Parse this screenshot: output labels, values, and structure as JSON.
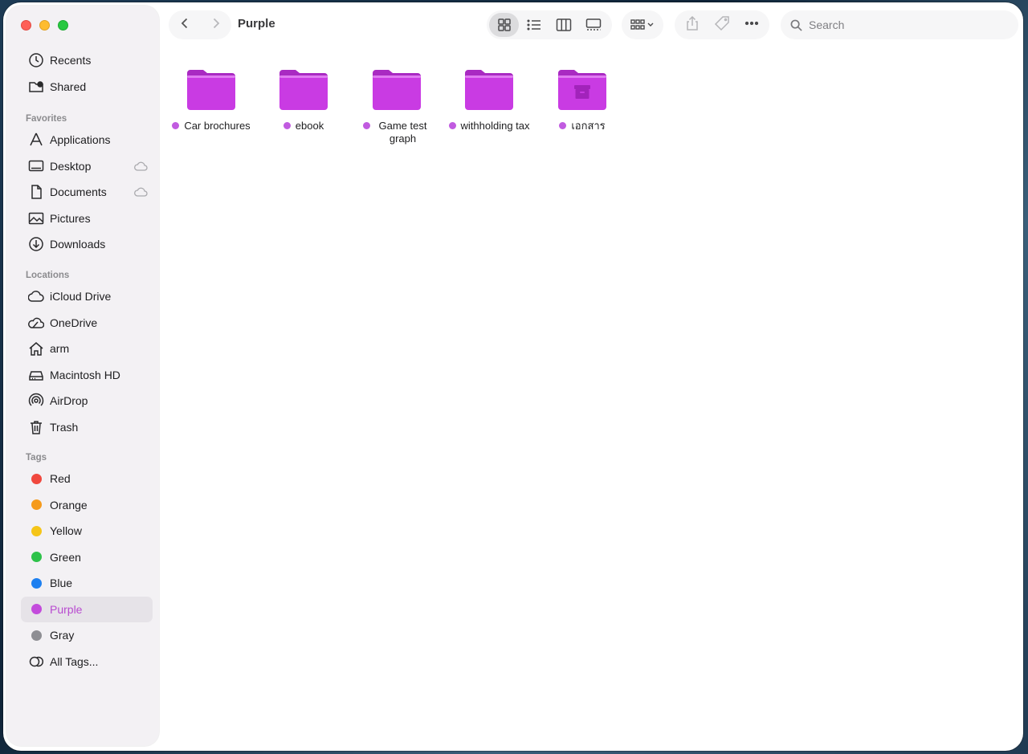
{
  "window": {
    "title": "Purple"
  },
  "sidebar": {
    "top_items": [
      {
        "label": "Recents",
        "icon": "clock-icon"
      },
      {
        "label": "Shared",
        "icon": "shared-folder-icon"
      }
    ],
    "favorites": {
      "heading": "Favorites",
      "items": [
        {
          "label": "Applications",
          "icon": "applications-icon",
          "cloud": false
        },
        {
          "label": "Desktop",
          "icon": "desktop-icon",
          "cloud": true
        },
        {
          "label": "Documents",
          "icon": "document-icon",
          "cloud": true
        },
        {
          "label": "Pictures",
          "icon": "pictures-icon",
          "cloud": false
        },
        {
          "label": "Downloads",
          "icon": "download-icon",
          "cloud": false
        }
      ]
    },
    "locations": {
      "heading": "Locations",
      "items": [
        {
          "label": "iCloud Drive",
          "icon": "cloud-icon"
        },
        {
          "label": "OneDrive",
          "icon": "onedrive-icon"
        },
        {
          "label": "arm",
          "icon": "home-icon"
        },
        {
          "label": "Macintosh HD",
          "icon": "hard-drive-icon"
        },
        {
          "label": "AirDrop",
          "icon": "airdrop-icon"
        },
        {
          "label": "Trash",
          "icon": "trash-icon"
        }
      ]
    },
    "tags": {
      "heading": "Tags",
      "items": [
        {
          "label": "Red",
          "color": "#f0483e"
        },
        {
          "label": "Orange",
          "color": "#f59a1b"
        },
        {
          "label": "Yellow",
          "color": "#f5c518"
        },
        {
          "label": "Green",
          "color": "#2ec24a"
        },
        {
          "label": "Blue",
          "color": "#1e80f0"
        },
        {
          "label": "Purple",
          "color": "#c34bdc",
          "selected": true
        },
        {
          "label": "Gray",
          "color": "#8e8e93"
        }
      ],
      "all_tags_label": "All Tags..."
    }
  },
  "toolbar": {
    "search_placeholder": "Search"
  },
  "content": {
    "items": [
      {
        "label": "Car brochures",
        "tag_color": "#c15be0",
        "archive": false
      },
      {
        "label": "ebook",
        "tag_color": "#c15be0",
        "archive": false
      },
      {
        "label": "Game test graph",
        "tag_color": "#c15be0",
        "archive": false
      },
      {
        "label": "withholding tax",
        "tag_color": "#c15be0",
        "archive": false
      },
      {
        "label": "เอกสาร",
        "tag_color": "#c15be0",
        "archive": true
      }
    ],
    "folder_color": "#c93be3"
  }
}
